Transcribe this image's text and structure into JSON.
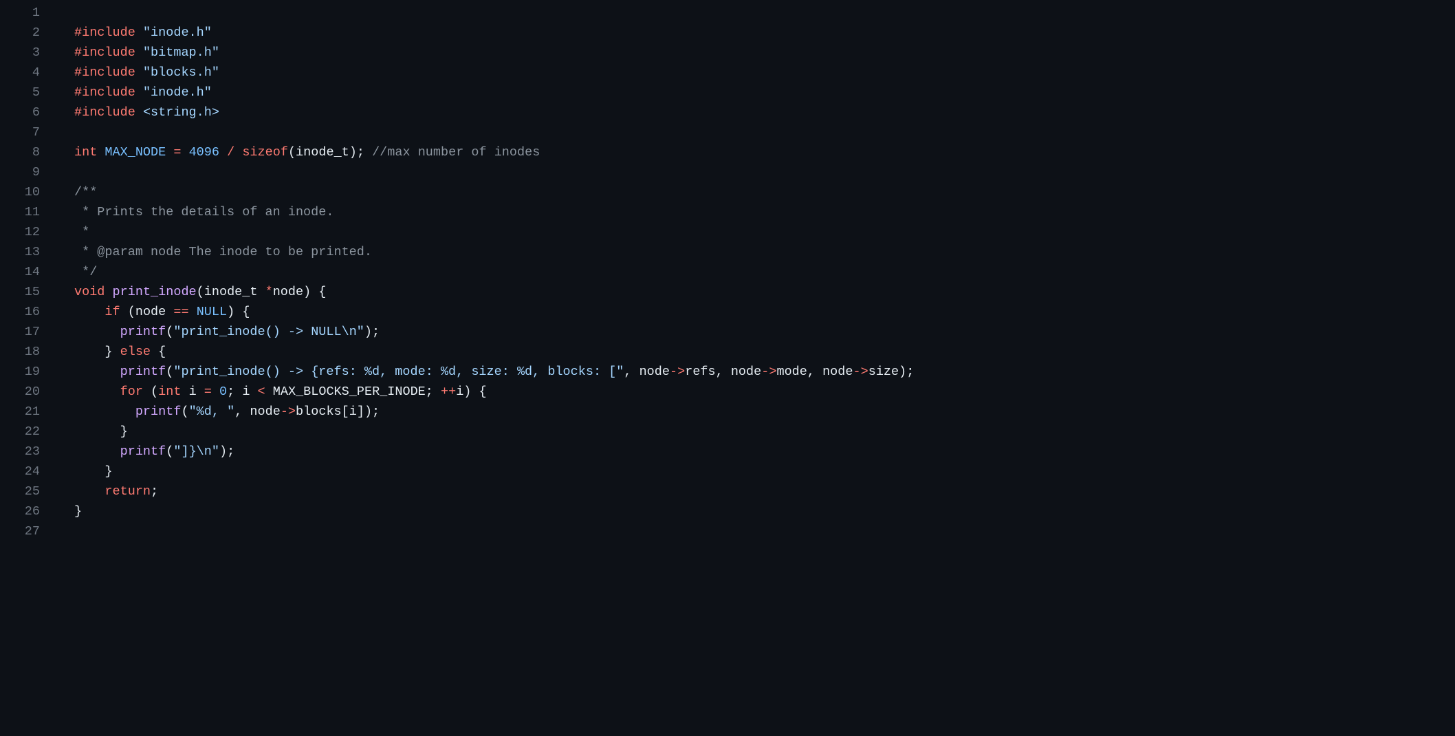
{
  "code": {
    "lines": [
      {
        "n": 1,
        "tokens": []
      },
      {
        "n": 2,
        "tokens": [
          {
            "c": "keyword",
            "t": "#include"
          },
          {
            "c": "plain",
            "t": " "
          },
          {
            "c": "string",
            "t": "\"inode.h\""
          }
        ]
      },
      {
        "n": 3,
        "tokens": [
          {
            "c": "keyword",
            "t": "#include"
          },
          {
            "c": "plain",
            "t": " "
          },
          {
            "c": "string",
            "t": "\"bitmap.h\""
          }
        ]
      },
      {
        "n": 4,
        "tokens": [
          {
            "c": "keyword",
            "t": "#include"
          },
          {
            "c": "plain",
            "t": " "
          },
          {
            "c": "string",
            "t": "\"blocks.h\""
          }
        ]
      },
      {
        "n": 5,
        "tokens": [
          {
            "c": "keyword",
            "t": "#include"
          },
          {
            "c": "plain",
            "t": " "
          },
          {
            "c": "string",
            "t": "\"inode.h\""
          }
        ]
      },
      {
        "n": 6,
        "tokens": [
          {
            "c": "keyword",
            "t": "#include"
          },
          {
            "c": "plain",
            "t": " "
          },
          {
            "c": "string",
            "t": "<string.h>"
          }
        ]
      },
      {
        "n": 7,
        "tokens": []
      },
      {
        "n": 8,
        "tokens": [
          {
            "c": "keyword",
            "t": "int"
          },
          {
            "c": "plain",
            "t": " "
          },
          {
            "c": "constant",
            "t": "MAX_NODE"
          },
          {
            "c": "plain",
            "t": " "
          },
          {
            "c": "operator",
            "t": "="
          },
          {
            "c": "plain",
            "t": " "
          },
          {
            "c": "number",
            "t": "4096"
          },
          {
            "c": "plain",
            "t": " "
          },
          {
            "c": "operator",
            "t": "/"
          },
          {
            "c": "plain",
            "t": " "
          },
          {
            "c": "keyword",
            "t": "sizeof"
          },
          {
            "c": "plain",
            "t": "(inode_t); "
          },
          {
            "c": "comment",
            "t": "//max number of inodes"
          }
        ]
      },
      {
        "n": 9,
        "tokens": []
      },
      {
        "n": 10,
        "tokens": [
          {
            "c": "comment",
            "t": "/**"
          }
        ]
      },
      {
        "n": 11,
        "tokens": [
          {
            "c": "comment",
            "t": " * Prints the details of an inode."
          }
        ]
      },
      {
        "n": 12,
        "tokens": [
          {
            "c": "comment",
            "t": " *"
          }
        ]
      },
      {
        "n": 13,
        "tokens": [
          {
            "c": "comment",
            "t": " * @param node The inode to be printed."
          }
        ]
      },
      {
        "n": 14,
        "tokens": [
          {
            "c": "comment",
            "t": " */"
          }
        ]
      },
      {
        "n": 15,
        "tokens": [
          {
            "c": "keyword",
            "t": "void"
          },
          {
            "c": "plain",
            "t": " "
          },
          {
            "c": "function",
            "t": "print_inode"
          },
          {
            "c": "plain",
            "t": "(inode_t "
          },
          {
            "c": "operator",
            "t": "*"
          },
          {
            "c": "plain",
            "t": "node) {"
          }
        ]
      },
      {
        "n": 16,
        "tokens": [
          {
            "c": "plain",
            "t": "    "
          },
          {
            "c": "keyword",
            "t": "if"
          },
          {
            "c": "plain",
            "t": " (node "
          },
          {
            "c": "operator",
            "t": "=="
          },
          {
            "c": "plain",
            "t": " "
          },
          {
            "c": "constant",
            "t": "NULL"
          },
          {
            "c": "plain",
            "t": ") {"
          }
        ]
      },
      {
        "n": 17,
        "tokens": [
          {
            "c": "plain",
            "t": "      "
          },
          {
            "c": "function",
            "t": "printf"
          },
          {
            "c": "plain",
            "t": "("
          },
          {
            "c": "string",
            "t": "\"print_inode() -> NULL\\n\""
          },
          {
            "c": "plain",
            "t": ");"
          }
        ]
      },
      {
        "n": 18,
        "tokens": [
          {
            "c": "plain",
            "t": "    } "
          },
          {
            "c": "keyword",
            "t": "else"
          },
          {
            "c": "plain",
            "t": " {"
          }
        ]
      },
      {
        "n": 19,
        "tokens": [
          {
            "c": "plain",
            "t": "      "
          },
          {
            "c": "function",
            "t": "printf"
          },
          {
            "c": "plain",
            "t": "("
          },
          {
            "c": "string",
            "t": "\"print_inode() -> {refs: %d, mode: %d, size: %d, blocks: [\""
          },
          {
            "c": "plain",
            "t": ", node"
          },
          {
            "c": "operator",
            "t": "->"
          },
          {
            "c": "plain",
            "t": "refs, node"
          },
          {
            "c": "operator",
            "t": "->"
          },
          {
            "c": "plain",
            "t": "mode, node"
          },
          {
            "c": "operator",
            "t": "->"
          },
          {
            "c": "plain",
            "t": "size);"
          }
        ]
      },
      {
        "n": 20,
        "tokens": [
          {
            "c": "plain",
            "t": "      "
          },
          {
            "c": "keyword",
            "t": "for"
          },
          {
            "c": "plain",
            "t": " ("
          },
          {
            "c": "keyword",
            "t": "int"
          },
          {
            "c": "plain",
            "t": " i "
          },
          {
            "c": "operator",
            "t": "="
          },
          {
            "c": "plain",
            "t": " "
          },
          {
            "c": "number",
            "t": "0"
          },
          {
            "c": "plain",
            "t": "; i "
          },
          {
            "c": "operator",
            "t": "<"
          },
          {
            "c": "plain",
            "t": " MAX_BLOCKS_PER_INODE; "
          },
          {
            "c": "operator",
            "t": "++"
          },
          {
            "c": "plain",
            "t": "i) {"
          }
        ]
      },
      {
        "n": 21,
        "tokens": [
          {
            "c": "plain",
            "t": "        "
          },
          {
            "c": "function",
            "t": "printf"
          },
          {
            "c": "plain",
            "t": "("
          },
          {
            "c": "string",
            "t": "\"%d, \""
          },
          {
            "c": "plain",
            "t": ", node"
          },
          {
            "c": "operator",
            "t": "->"
          },
          {
            "c": "plain",
            "t": "blocks[i]);"
          }
        ]
      },
      {
        "n": 22,
        "tokens": [
          {
            "c": "plain",
            "t": "      }"
          }
        ]
      },
      {
        "n": 23,
        "tokens": [
          {
            "c": "plain",
            "t": "      "
          },
          {
            "c": "function",
            "t": "printf"
          },
          {
            "c": "plain",
            "t": "("
          },
          {
            "c": "string",
            "t": "\"]}\\n\""
          },
          {
            "c": "plain",
            "t": ");"
          }
        ]
      },
      {
        "n": 24,
        "tokens": [
          {
            "c": "plain",
            "t": "    }"
          }
        ]
      },
      {
        "n": 25,
        "tokens": [
          {
            "c": "plain",
            "t": "    "
          },
          {
            "c": "keyword",
            "t": "return"
          },
          {
            "c": "plain",
            "t": ";"
          }
        ]
      },
      {
        "n": 26,
        "tokens": [
          {
            "c": "plain",
            "t": "}"
          }
        ]
      },
      {
        "n": 27,
        "tokens": []
      }
    ]
  }
}
